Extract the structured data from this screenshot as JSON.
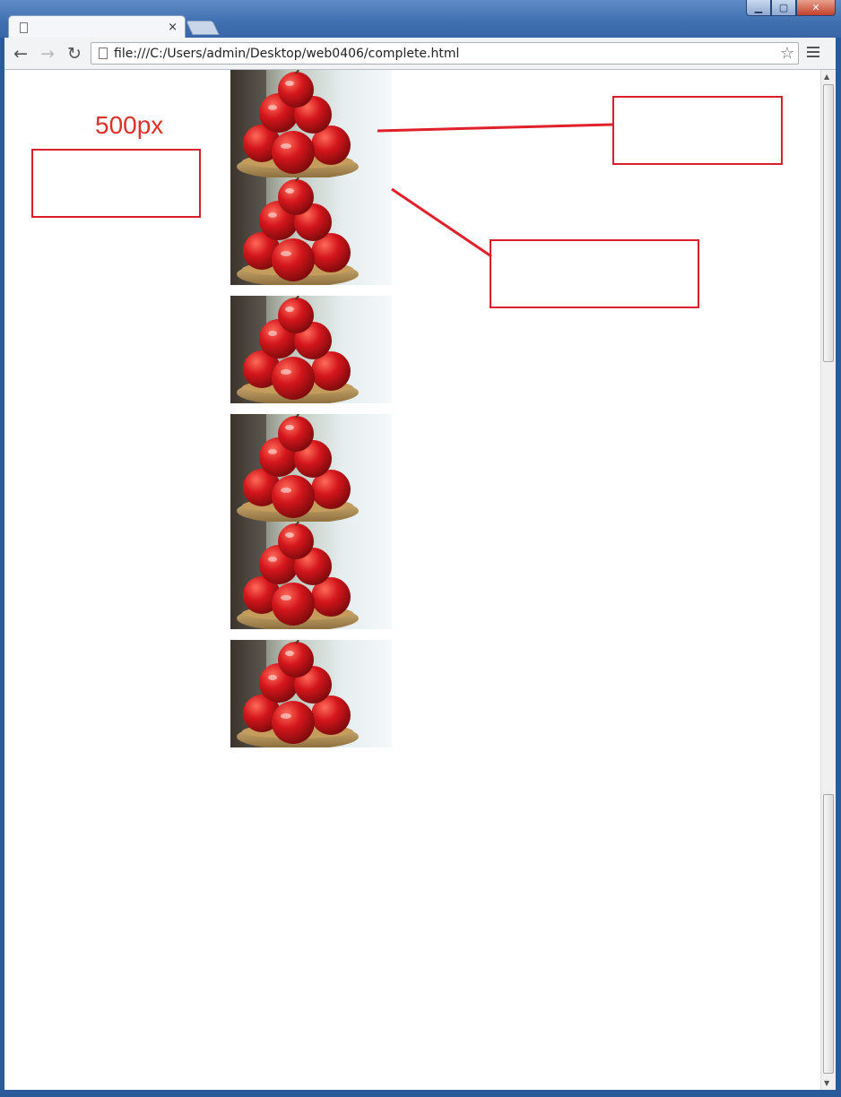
{
  "browser": {
    "tab_title": "",
    "tab_close": "×",
    "url": "file:///C:/Users/admin/Desktop/web0406/complete.html",
    "icons": [
      "back-arrow-icon",
      "forward-arrow-icon",
      "reload-icon",
      "page-icon",
      "star-icon",
      "menu-icon"
    ]
  },
  "page": {
    "items": [
      {
        "type": "long",
        "text": ""
      },
      {
        "type": "short",
        "text": ""
      },
      {
        "type": "short",
        "text": ""
      },
      {
        "type": "long",
        "text": ""
      },
      {
        "type": "short",
        "text": ""
      },
      {
        "type": "short",
        "text": ""
      }
    ]
  },
  "annotations": {
    "width_label": "500px",
    "box_width_note": "",
    "left_align_note": "",
    "gap_note": "",
    "accent_color": "#e0302a"
  }
}
